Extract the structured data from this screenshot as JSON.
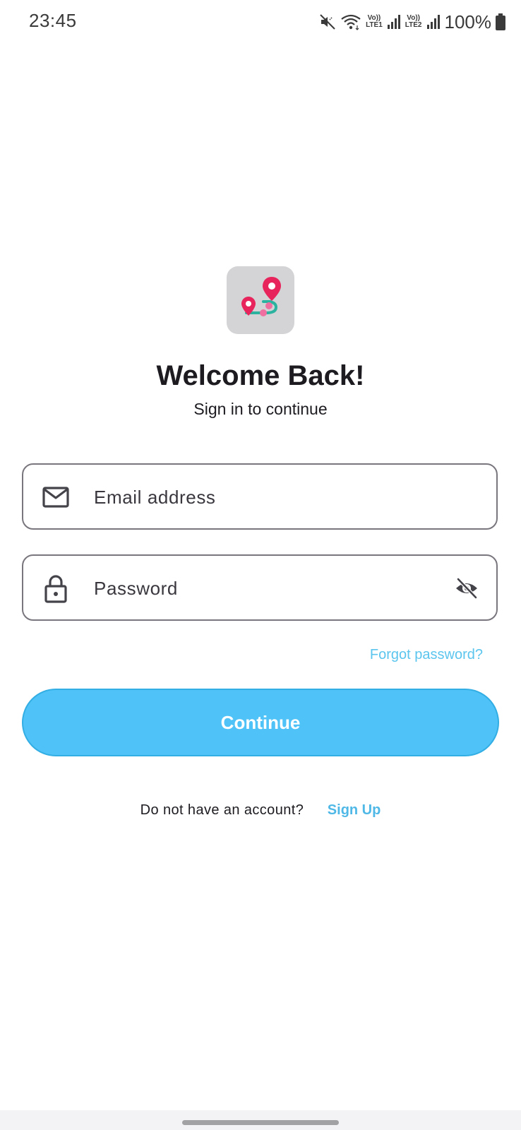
{
  "status_bar": {
    "time": "23:45",
    "sim1_tag_top": "Vo))",
    "sim1_tag_bottom": "LTE1",
    "sim2_tag_top": "Vo))",
    "sim2_tag_bottom": "LTE2",
    "battery": "100%",
    "icons": [
      "mute-icon",
      "wifi-icon",
      "signal-icon",
      "signal-icon",
      "battery-icon"
    ]
  },
  "header": {
    "logo_icon": "route-pins-icon",
    "title": "Welcome Back!",
    "subtitle": "Sign in to continue"
  },
  "form": {
    "email": {
      "icon": "mail-icon",
      "placeholder": "Email address",
      "value": ""
    },
    "password": {
      "icon": "lock-icon",
      "placeholder": "Password",
      "value": "",
      "toggle_icon": "eye-off-icon"
    },
    "forgot_label": "Forgot password?",
    "submit_label": "Continue"
  },
  "footer": {
    "prompt": "Do not have an account?",
    "signup_label": "Sign Up"
  },
  "colors": {
    "accent": "#4fc3f7",
    "link": "#5bc5ee",
    "logo_bg": "#d4d4d6",
    "pin_red": "#e8245c",
    "route_teal": "#2bb3a0"
  }
}
